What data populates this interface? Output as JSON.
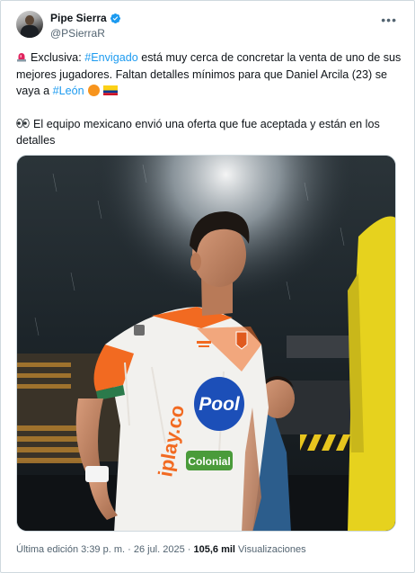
{
  "author": {
    "display_name": "Pipe Sierra",
    "handle": "@PSierraR"
  },
  "tweet": {
    "para1_prefix": "Exclusiva: ",
    "hashtag1": "#Envigado",
    "para1_middle": " está muy cerca de concretar la venta de uno de sus mejores jugadores. Faltan detalles mínimos para que Daniel Arcila (23) se vaya a ",
    "hashtag2": "#León",
    "para2": "El equipo mexicano envió una oferta que fue aceptada y están en los detalles"
  },
  "media": {
    "kit_sponsor_1": "Pool",
    "kit_sponsor_2": "iplay.co",
    "kit_sponsor_3": "Colonial"
  },
  "footer": {
    "edited": "Última edición 3:39 p. m. · 26 jul. 2025 · ",
    "views_count": "105,6 mil",
    "views_label": " Visualizaciones"
  },
  "icons": {
    "verified": "verified-badge-icon",
    "more": "more-options-icon",
    "siren": "siren-emoji",
    "eyes": "eyes-emoji",
    "orange_circle": "orange-circle-emoji",
    "flag": "colombia-flag-emoji"
  },
  "colors": {
    "link": "#1d9bf0",
    "secondary_text": "#536471",
    "primary_text": "#0f1419",
    "jersey_orange": "#f26a21",
    "keeper_yellow": "#e6d21e"
  }
}
